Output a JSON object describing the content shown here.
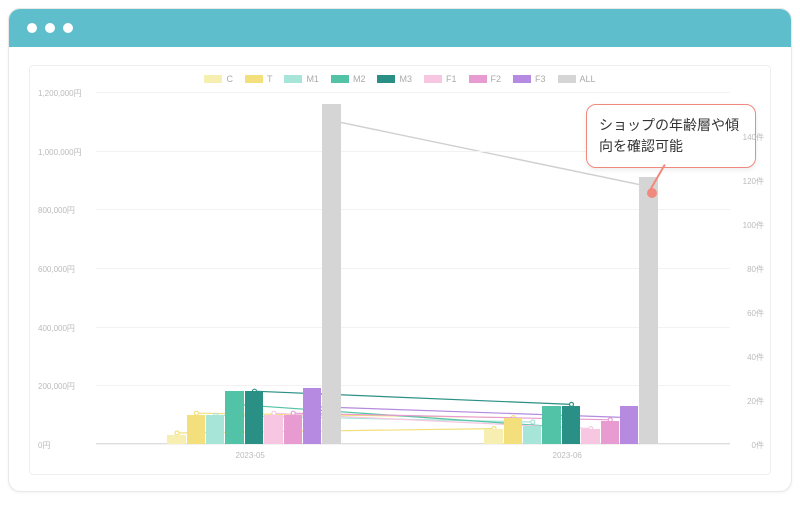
{
  "callout": {
    "text": "ショップの年齢層や傾向を確認可能"
  },
  "legend": [
    {
      "name": "C",
      "color": "#f7eeb2"
    },
    {
      "name": "T",
      "color": "#f3df7b"
    },
    {
      "name": "M1",
      "color": "#a7e5d9"
    },
    {
      "name": "M2",
      "color": "#52c3a6"
    },
    {
      "name": "M3",
      "color": "#2a8f84"
    },
    {
      "name": "F1",
      "color": "#f7c7e2"
    },
    {
      "name": "F2",
      "color": "#e79bd0"
    },
    {
      "name": "F3",
      "color": "#b58ae0"
    },
    {
      "name": "ALL",
      "color": "#d5d5d5"
    }
  ],
  "left_axis": {
    "unit": "円",
    "ticks": [
      0,
      200000,
      400000,
      600000,
      800000,
      1000000,
      1200000
    ],
    "labels": [
      "0円",
      "200,000円",
      "400,000円",
      "600,000円",
      "800,000円",
      "1,000,000円",
      "1,200,000円"
    ],
    "max": 1200000
  },
  "right_axis": {
    "unit": "件",
    "ticks": [
      0,
      20,
      40,
      60,
      80,
      100,
      120,
      140
    ],
    "labels": [
      "0件",
      "20件",
      "40件",
      "60件",
      "80件",
      "100件",
      "120件",
      "140件"
    ],
    "max": 160
  },
  "x_categories": [
    "2023-05",
    "2023-06"
  ],
  "chart_data": {
    "type": "bar",
    "title": "",
    "xlabel": "",
    "ylabel_left": "円",
    "ylabel_right": "件",
    "ylim_left": [
      0,
      1200000
    ],
    "ylim_right": [
      0,
      160
    ],
    "categories": [
      "2023-05",
      "2023-06"
    ],
    "bar_series": [
      {
        "name": "C",
        "color": "#f7eeb2",
        "values": [
          30000,
          50000
        ]
      },
      {
        "name": "T",
        "color": "#f3df7b",
        "values": [
          100000,
          90000
        ]
      },
      {
        "name": "M1",
        "color": "#a7e5d9",
        "values": [
          100000,
          60000
        ]
      },
      {
        "name": "M2",
        "color": "#52c3a6",
        "values": [
          180000,
          130000
        ]
      },
      {
        "name": "M3",
        "color": "#2a8f84",
        "values": [
          180000,
          130000
        ]
      },
      {
        "name": "F1",
        "color": "#f7c7e2",
        "values": [
          100000,
          50000
        ]
      },
      {
        "name": "F2",
        "color": "#e79bd0",
        "values": [
          100000,
          80000
        ]
      },
      {
        "name": "F3",
        "color": "#b58ae0",
        "values": [
          190000,
          130000
        ]
      },
      {
        "name": "ALL",
        "color": "#d5d5d5",
        "values": [
          1160000,
          910000
        ]
      }
    ],
    "line_series_right_axis": [
      {
        "name": "C",
        "color": "#f3df7b",
        "values": [
          5,
          7
        ]
      },
      {
        "name": "T",
        "color": "#f3df7b",
        "values": [
          14,
          12
        ]
      },
      {
        "name": "M1",
        "color": "#a7e5d9",
        "values": [
          13,
          10
        ]
      },
      {
        "name": "M2",
        "color": "#52c3a6",
        "values": [
          18,
          8
        ]
      },
      {
        "name": "M3",
        "color": "#2a8f84",
        "values": [
          24,
          18
        ]
      },
      {
        "name": "F1",
        "color": "#f7c7e2",
        "values": [
          14,
          7
        ]
      },
      {
        "name": "F2",
        "color": "#e79bd0",
        "values": [
          14,
          11
        ]
      },
      {
        "name": "F3",
        "color": "#b58ae0",
        "values": [
          17,
          12
        ]
      },
      {
        "name": "ALL",
        "color": "#cfcfcf",
        "values": [
          147,
          117
        ]
      }
    ]
  }
}
